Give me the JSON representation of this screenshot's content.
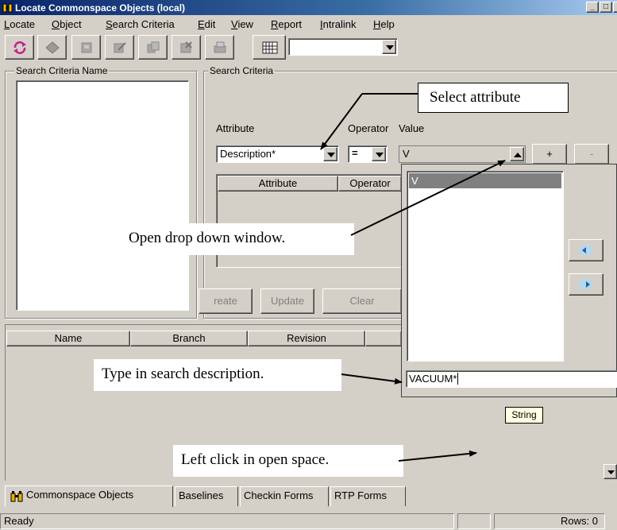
{
  "window": {
    "title": "Locate Commonspace Objects (local)",
    "minimize": "_",
    "maximize": "□",
    "close": "x"
  },
  "menu": [
    "Locate",
    "Object",
    "Search Criteria",
    "Edit",
    "View",
    "Report",
    "Intralink",
    "Help"
  ],
  "menu_underline": [
    "L",
    "O",
    "S",
    "E",
    "V",
    "R",
    "I",
    "H"
  ],
  "toolbar": {
    "combo_value": ""
  },
  "criteria_name_panel": {
    "title": "Search Criteria Name"
  },
  "search_criteria": {
    "title": "Search Criteria",
    "attribute_label": "Attribute",
    "operator_label": "Operator",
    "value_label": "Value",
    "attribute_value": "Description*",
    "operator_value": "=",
    "value_value": "V",
    "plus": "+",
    "minus": "-",
    "table_columns": [
      "Attribute",
      "Operator"
    ],
    "buttons": [
      "reate",
      "Update",
      "Clear"
    ]
  },
  "dropdown": {
    "items": [
      "V"
    ],
    "input_value": "VACUUM*",
    "tooltip": "String"
  },
  "results": {
    "columns": [
      "Name",
      "Branch",
      "Revision"
    ]
  },
  "tabs": [
    "Commonspace Objects",
    "Baselines",
    "Checkin Forms",
    "RTP Forms"
  ],
  "status": {
    "text": "Ready",
    "rows": "Rows: 0"
  },
  "annotations": {
    "select_attribute": "Select attribute",
    "open_dropdown": "Open drop down window.",
    "type_description": "Type in search description.",
    "left_click": "Left click in open space."
  }
}
